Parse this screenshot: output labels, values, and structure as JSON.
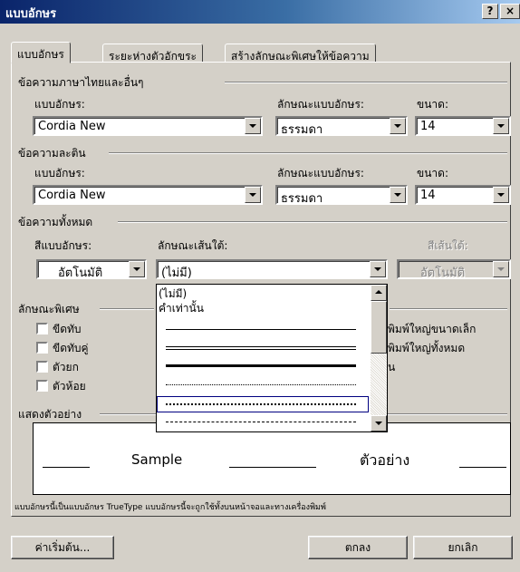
{
  "window": {
    "title": "แบบอักษร",
    "help_glyph": "?",
    "close_glyph": "×"
  },
  "tabs": [
    {
      "label": "แบบอักษร",
      "selected": true
    },
    {
      "label": "ระยะห่างตัวอักขระ",
      "selected": false
    },
    {
      "label": "สร้างลักษณะพิเศษให้ข้อความ",
      "selected": false
    }
  ],
  "thai_section": {
    "heading": "ข้อความภาษาไทยและอื่นๆ",
    "font_label": "แบบอักษร:",
    "font_value": "Cordia New",
    "style_label": "ลักษณะแบบอักษร:",
    "style_value": "ธรรมดา",
    "size_label": "ขนาด:",
    "size_value": "14"
  },
  "latin_section": {
    "heading": "ข้อความละติน",
    "font_label": "แบบอักษร:",
    "font_value": "Cordia New",
    "style_label": "ลักษณะแบบอักษร:",
    "style_value": "ธรรมดา",
    "size_label": "ขนาด:",
    "size_value": "14"
  },
  "all_text_section": {
    "heading": "ข้อความทั้งหมด",
    "color_label": "สีแบบอักษร:",
    "color_value": "อัตโนมัติ",
    "underline_label": "ลักษณะเส้นใต้:",
    "underline_value": "(ไม่มี)",
    "underline_color_label": "สีเส้นใต้:",
    "underline_color_value": "อัตโนมัติ"
  },
  "underline_dropdown": {
    "options": [
      "(ไม่มี)",
      "คำเท่านั้น"
    ],
    "line_styles": [
      "single",
      "double",
      "thick",
      "dotted",
      "dense-dotted",
      "dashed"
    ],
    "highlight_color": "#000080"
  },
  "effects_section": {
    "heading": "ลักษณะพิเศษ",
    "left_items": [
      {
        "label": "ขีดทับ",
        "checked": false
      },
      {
        "label": "ขีดทับคู่",
        "checked": false
      },
      {
        "label": "ตัวยก",
        "checked": false
      },
      {
        "label": "ตัวห้อย",
        "checked": false
      }
    ],
    "right_items": [
      {
        "label": "พิมพ์ใหญ่ขนาดเล็ก",
        "checked": false
      },
      {
        "label": "พิมพ์ใหญ่ทั้งหมด",
        "checked": false
      },
      {
        "label": "น",
        "checked": false
      }
    ]
  },
  "preview_section": {
    "heading": "แสดงตัวอย่าง",
    "sample_text": "Sample",
    "thai_sample_text": "ตัวอย่าง",
    "note": "แบบอักษรนี้เป็นแบบอักษร TrueType  แบบอักษรนี้จะถูกใช้ทั้งบนหน้าจอและทางเครื่องพิมพ์"
  },
  "buttons": {
    "default": "ค่าเริ่มต้น...",
    "ok": "ตกลง",
    "cancel": "ยกเลิก"
  }
}
